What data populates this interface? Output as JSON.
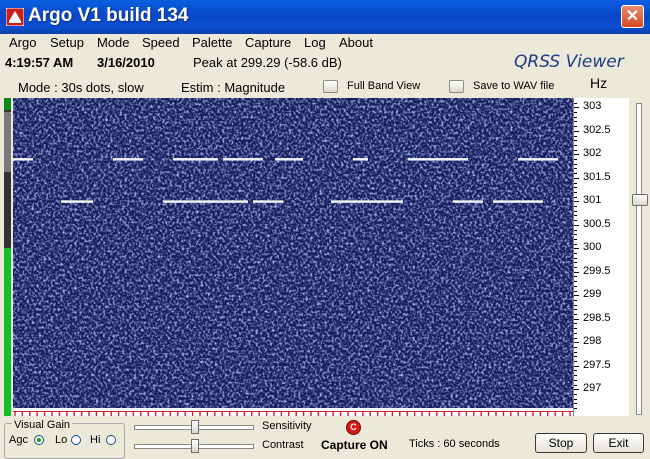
{
  "window": {
    "title": "Argo V1 build 134",
    "close_glyph": "✕"
  },
  "menu": [
    "Argo",
    "Setup",
    "Mode",
    "Speed",
    "Palette",
    "Capture",
    "Log",
    "About"
  ],
  "info": {
    "time": "4:19:57 AM",
    "date": "3/16/2010",
    "peak": "Peak at 299.29 (-58.6 dB)",
    "brand": "QRSS Viewer"
  },
  "modebar": {
    "mode": "Mode : 30s dots, slow",
    "estim": "Estim : Magnitude",
    "full_band": "Full Band View",
    "save_wav": "Save to WAV file",
    "unit": "Hz"
  },
  "freq_scale": {
    "range": [
      296.6,
      303.2
    ],
    "labels": [
      "303",
      "302.5",
      "302",
      "301.5",
      "301",
      "300.5",
      "300",
      "299.5",
      "299",
      "298.5",
      "298",
      "297.5",
      "297"
    ]
  },
  "signals": [
    {
      "freq": 301.9,
      "segments": [
        [
          0,
          20
        ],
        [
          100,
          130
        ],
        [
          160,
          205
        ],
        [
          210,
          250
        ],
        [
          262,
          290
        ],
        [
          340,
          355
        ],
        [
          395,
          455
        ],
        [
          505,
          545
        ]
      ]
    },
    {
      "freq": 301.0,
      "segments": [
        [
          48,
          80
        ],
        [
          150,
          235
        ],
        [
          240,
          270
        ],
        [
          318,
          390
        ],
        [
          440,
          470
        ],
        [
          480,
          530
        ]
      ]
    }
  ],
  "bottom": {
    "visual_gain": "Visual Gain",
    "agc": "Agc",
    "lo": "Lo",
    "hi": "Hi",
    "gain_selected": "Agc",
    "sensitivity": "Sensitivity",
    "contrast": "Contrast",
    "capture_status": "Capture ON",
    "ticks": "Ticks   : 60 seconds",
    "stop": "Stop",
    "exit": "Exit"
  },
  "colors": {
    "spectrogram_bg": "#1A2260",
    "signal": "#FFFFFF",
    "titlebar": "#0A4ED0",
    "ruler_tick": "#D0202A"
  }
}
